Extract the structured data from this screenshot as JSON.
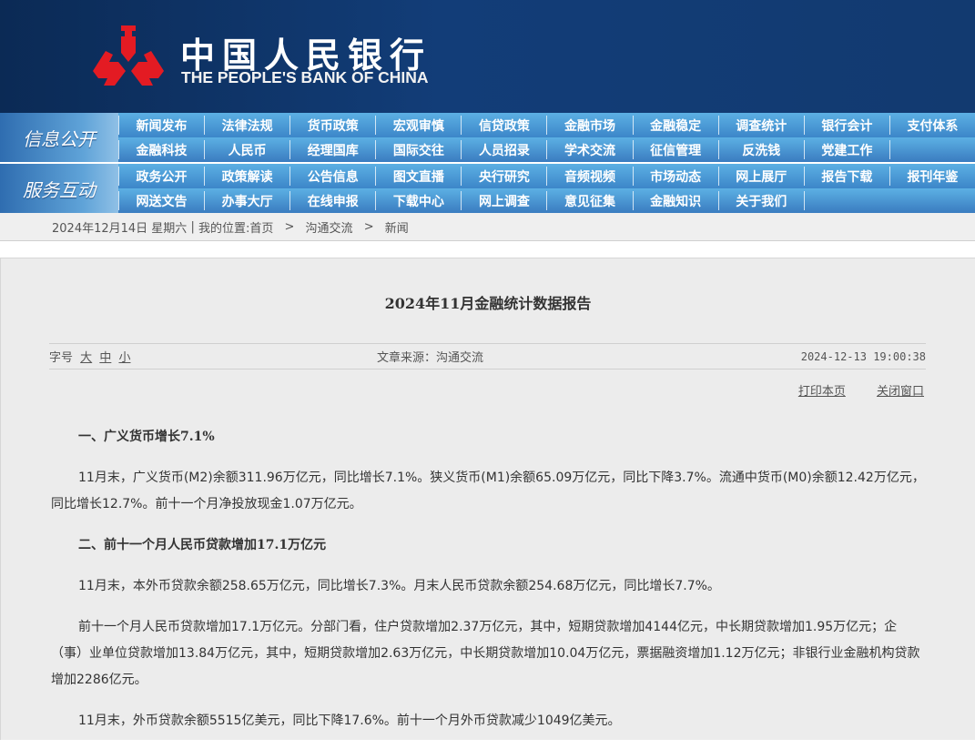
{
  "header": {
    "logo_cn": "中国人民银行",
    "logo_en": "THE PEOPLE'S BANK OF CHINA",
    "emblem_color": "#e31b23"
  },
  "nav": {
    "groups": [
      {
        "label": "信息公开",
        "rows": [
          [
            "新闻发布",
            "法律法规",
            "货币政策",
            "宏观审慎",
            "信贷政策",
            "金融市场",
            "金融稳定",
            "调查统计",
            "银行会计",
            "支付体系"
          ],
          [
            "金融科技",
            "人民币",
            "经理国库",
            "国际交往",
            "人员招录",
            "学术交流",
            "征信管理",
            "反洗钱",
            "党建工作",
            ""
          ]
        ]
      },
      {
        "label": "服务互动",
        "rows": [
          [
            "政务公开",
            "政策解读",
            "公告信息",
            "图文直播",
            "央行研究",
            "音频视频",
            "市场动态",
            "网上展厅",
            "报告下载",
            "报刊年鉴"
          ],
          [
            "网送文告",
            "办事大厅",
            "在线申报",
            "下载中心",
            "网上调查",
            "意见征集",
            "金融知识",
            "关于我们",
            "",
            ""
          ]
        ]
      }
    ]
  },
  "breadcrumb": {
    "date": "2024年12月14日 星期六",
    "sep": " | ",
    "location": "我的位置:",
    "home": "首页",
    "arrow": " > ",
    "section": "沟通交流",
    "page": "新闻"
  },
  "article": {
    "title": "2024年11月金融统计数据报告",
    "font_size_label": "字号",
    "font_sizes": [
      "大",
      "中",
      "小"
    ],
    "source": "文章来源：沟通交流",
    "datetime": "2024-12-13 19:00:38",
    "print": "打印本页",
    "close": "关闭窗口",
    "blocks": [
      {
        "type": "h",
        "text": "一、广义货币增长7.1%"
      },
      {
        "type": "p",
        "text": "11月末，广义货币(M2)余额311.96万亿元，同比增长7.1%。狭义货币(M1)余额65.09万亿元，同比下降3.7%。流通中货币(M0)余额12.42万亿元，同比增长12.7%。前十一个月净投放现金1.07万亿元。"
      },
      {
        "type": "h",
        "text": "二、前十一个月人民币贷款增加17.1万亿元"
      },
      {
        "type": "p",
        "text": "11月末，本外币贷款余额258.65万亿元，同比增长7.3%。月末人民币贷款余额254.68万亿元，同比增长7.7%。"
      },
      {
        "type": "p",
        "text": "前十一个月人民币贷款增加17.1万亿元。分部门看，住户贷款增加2.37万亿元，其中，短期贷款增加4144亿元，中长期贷款增加1.95万亿元；企（事）业单位贷款增加13.84万亿元，其中，短期贷款增加2.63万亿元，中长期贷款增加10.04万亿元，票据融资增加1.12万亿元；非银行业金融机构贷款增加2286亿元。"
      },
      {
        "type": "p",
        "text": "11月末，外币贷款余额5515亿美元，同比下降17.6%。前十一个月外币贷款减少1049亿美元。"
      }
    ]
  }
}
